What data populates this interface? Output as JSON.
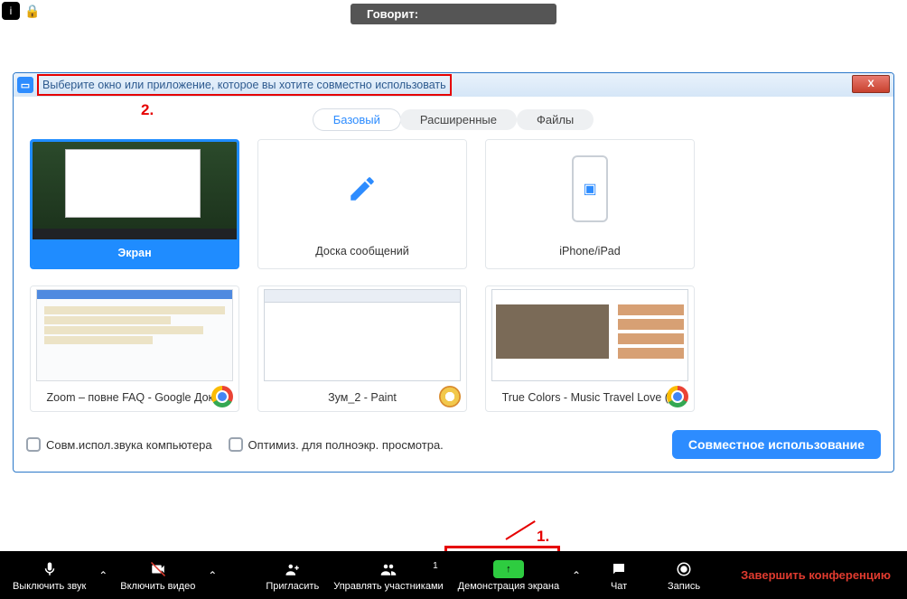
{
  "topbar": {
    "info_glyph": "i",
    "lock_glyph": "🔒",
    "speaking_label": "Говорит:"
  },
  "dialog": {
    "title": "Выберите окно или приложение, которое вы хотите совместно использовать",
    "close_glyph": "X",
    "tabs": {
      "basic": "Базовый",
      "advanced": "Расширенные",
      "files": "Файлы"
    },
    "sources": {
      "screen": "Экран",
      "whiteboard": "Доска сообщений",
      "iphone": "iPhone/iPad",
      "app1": "Zoom – повне FAQ - Google Док...",
      "app2": "Зум_2 - Paint",
      "app3": "True Colors - Music Travel Love (..."
    },
    "footer": {
      "chk_audio": "Совм.испол.звука компьютера",
      "chk_fullscreen": "Оптимиз. для полноэкр. просмотра.",
      "share_btn": "Совместное использование"
    }
  },
  "annotations": {
    "one": "1.",
    "two": "2."
  },
  "toolbar": {
    "mute": "Выключить звук",
    "video": "Включить видео",
    "invite": "Пригласить",
    "participants": "Управлять участниками",
    "participants_count": "1",
    "share": "Демонстрация экрана",
    "chat": "Чат",
    "record": "Запись",
    "end": "Завершить конференцию"
  }
}
